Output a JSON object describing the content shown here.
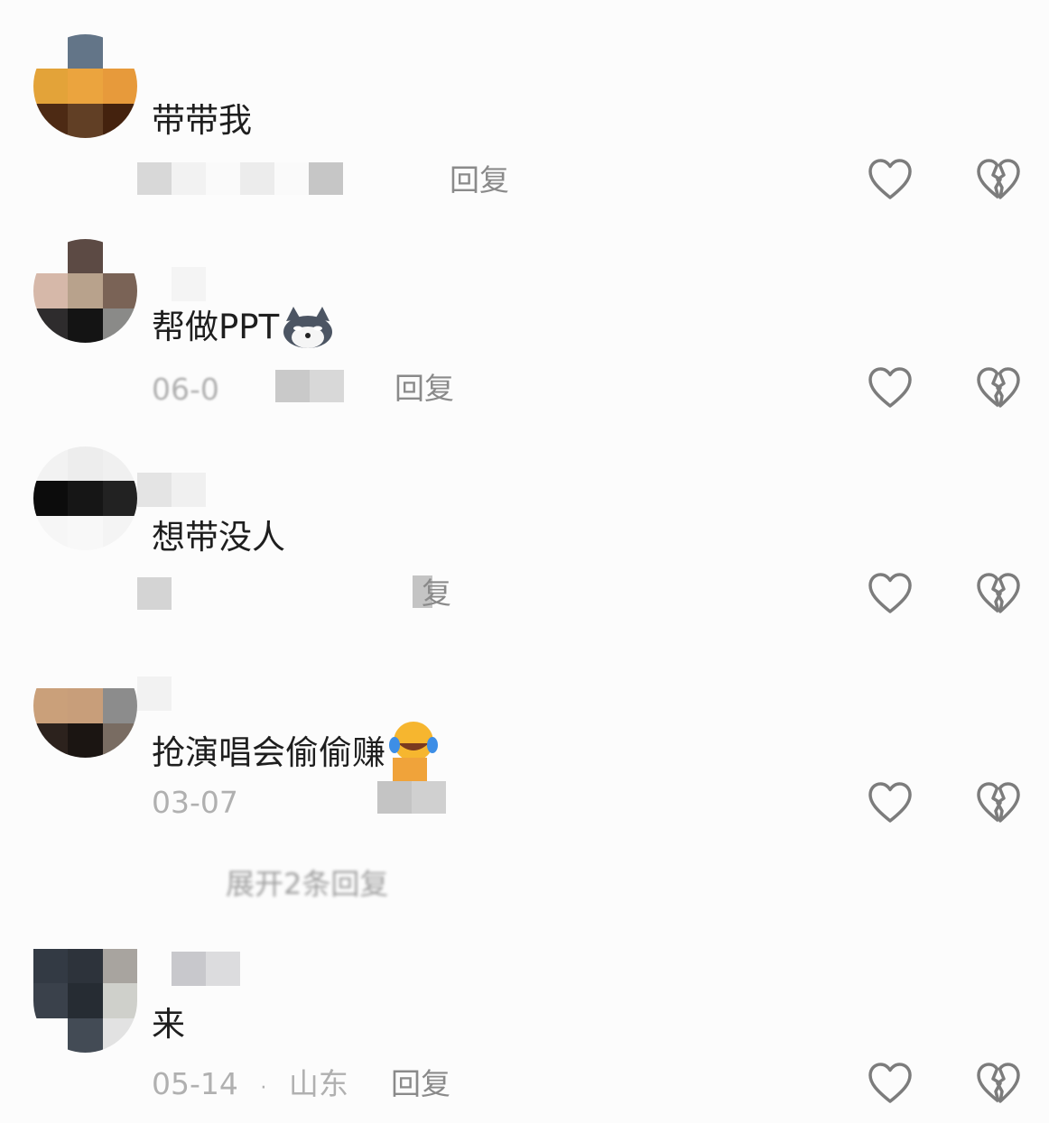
{
  "comments": [
    {
      "text": "带带我",
      "date": "",
      "location": "",
      "reply_label": "回复",
      "emoji": ""
    },
    {
      "text": "帮做PPT",
      "date": "06-0",
      "location": "",
      "reply_label": "回复",
      "emoji": "dog-emoji"
    },
    {
      "text": "想带没人",
      "date": "",
      "location": "",
      "reply_label": "复",
      "emoji": ""
    },
    {
      "text": "抢演唱会偷偷赚",
      "date": "03-07",
      "location": "",
      "reply_label": "",
      "emoji": "crying-laughing-emoji"
    },
    {
      "text": "来",
      "date": "05-14",
      "location": "山东",
      "separator": "·",
      "reply_label": "回复",
      "emoji": ""
    }
  ],
  "expand_replies_label": "展开2条回复",
  "icons": {
    "like": "heart-outline-icon",
    "dislike": "broken-heart-icon"
  },
  "colors": {
    "icon_stroke": "#7c7c7c",
    "meta_text": "#b0b0b0",
    "reply_text": "#8a8a8a"
  }
}
